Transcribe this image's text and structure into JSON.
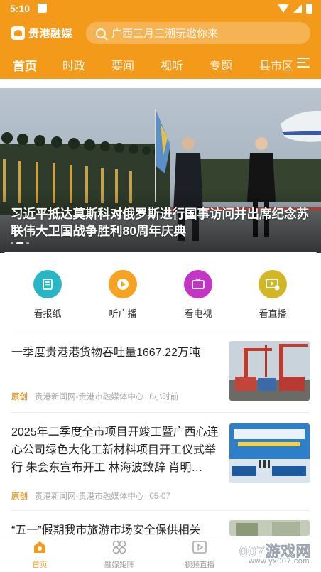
{
  "status_bar": {
    "time": "5:10"
  },
  "header": {
    "logo_text": "贵港融媒",
    "search_placeholder": "广西三月三潮玩邀你来",
    "tabs": [
      {
        "label": "首页",
        "active": true
      },
      {
        "label": "时政",
        "active": false
      },
      {
        "label": "要闻",
        "active": false
      },
      {
        "label": "视听",
        "active": false
      },
      {
        "label": "专题",
        "active": false
      },
      {
        "label": "县市区",
        "active": false
      }
    ],
    "accent_color": "#f39a1a"
  },
  "banner": {
    "title": "习近平抵达莫斯科对俄罗斯进行国事访问并出席纪念苏联伟大卫国战争胜利80周年庆典",
    "slide_count": 3,
    "active_slide": 2
  },
  "quick_links": [
    {
      "label": "看报纸",
      "icon": "newspaper-icon",
      "color": "#29b6c4"
    },
    {
      "label": "听广播",
      "icon": "play-circle-icon",
      "color": "#f6a321"
    },
    {
      "label": "看电视",
      "icon": "tv-icon",
      "color": "#c535c5"
    },
    {
      "label": "看直播",
      "icon": "live-icon",
      "color": "#d2b625"
    }
  ],
  "news": [
    {
      "title": "一季度贵港港货物吞吐量1667.22万吨",
      "tag": "原创",
      "source": "贵港新闻网-贵港市融媒体中心",
      "time": "6小时前",
      "thumb": "port-cranes-image"
    },
    {
      "title": "2025年二季度全市项目开竣工暨广西心连心公司绿色大化工新材料项目开工仪式举行 朱会东宣布开工 林海波致辞 肖明…",
      "tag": "原创",
      "source": "贵港新闻网-贵港市融媒体中心",
      "time": "05-07",
      "thumb": "ceremony-stage-image"
    },
    {
      "title": "“五一”假期我市旅游市场安全保供相关",
      "tag": "",
      "source": "",
      "time": "",
      "thumb": "partial-image"
    }
  ],
  "bottom_nav": [
    {
      "label": "首页",
      "icon": "home-icon",
      "active": true
    },
    {
      "label": "融媒矩阵",
      "icon": "grid-icon",
      "active": false
    },
    {
      "label": "视频直播",
      "icon": "video-icon",
      "active": false
    }
  ],
  "watermark": {
    "big": "007游戏网",
    "small": "www.yx007.com"
  }
}
